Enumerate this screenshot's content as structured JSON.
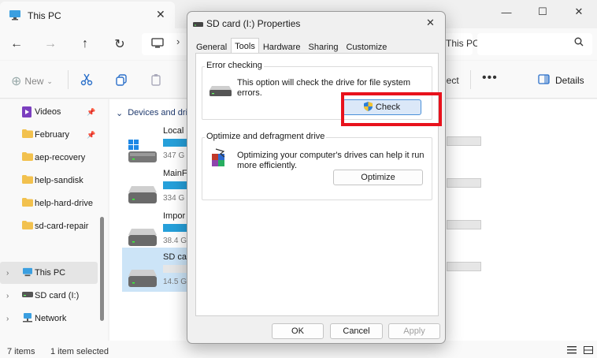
{
  "explorer": {
    "tab_title": "This PC",
    "address_crumb": "This PC",
    "toolbar": {
      "new_label": "New",
      "partial_label": "ject",
      "details_label": "Details"
    },
    "sidebar": {
      "items": [
        {
          "label": "Videos",
          "pinned": true
        },
        {
          "label": "February",
          "pinned": true
        },
        {
          "label": "aep-recovery"
        },
        {
          "label": "help-sandisk"
        },
        {
          "label": "help-hard-drive"
        },
        {
          "label": "sd-card-repair"
        },
        {
          "label": "This PC"
        },
        {
          "label": "SD card (I:)"
        },
        {
          "label": "Network"
        }
      ]
    },
    "section_label": "Devices and dri",
    "drives": [
      {
        "name": "Local",
        "size": "347 G"
      },
      {
        "name": "MainF",
        "size": "334 G"
      },
      {
        "name": "Impor",
        "size": "38.4 G"
      },
      {
        "name": "SD ca",
        "size": "14.5 G"
      }
    ],
    "status": {
      "items": "7 items",
      "selected": "1 item selected"
    }
  },
  "dialog": {
    "title": "SD card (I:) Properties",
    "tabs": [
      "General",
      "Tools",
      "Hardware",
      "Sharing",
      "Customize"
    ],
    "active_tab": "Tools",
    "error_checking": {
      "title": "Error checking",
      "text": "This option will check the drive for file system errors.",
      "button": "Check"
    },
    "optimize": {
      "title": "Optimize and defragment drive",
      "text": "Optimizing your computer's drives can help it run more efficiently.",
      "button": "Optimize"
    },
    "footer": {
      "ok": "OK",
      "cancel": "Cancel",
      "apply": "Apply"
    }
  },
  "colors": {
    "highlight": "#e8121c",
    "accent": "#26a0da",
    "selection": "#cce4f7"
  }
}
